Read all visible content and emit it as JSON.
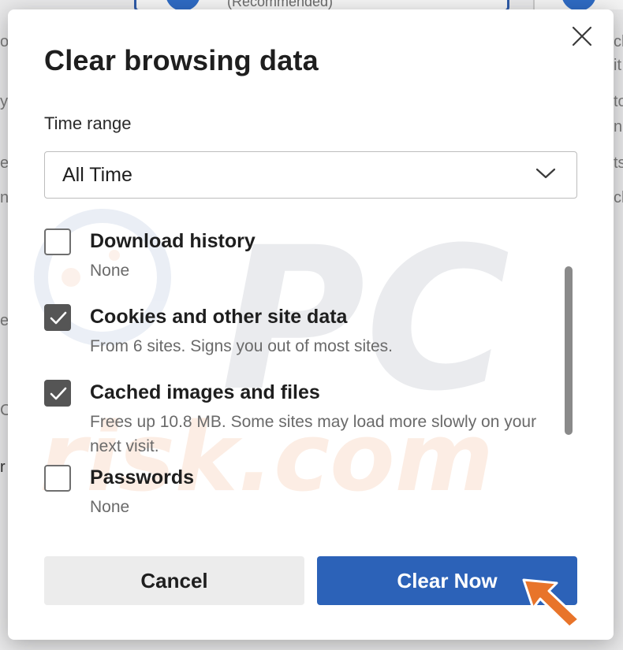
{
  "background": {
    "recommended_text": "(Recommended)",
    "left_fragments": [
      "o",
      "y",
      "e",
      "n",
      "e",
      "C",
      "r"
    ],
    "right_fragments": [
      "ck",
      "it",
      "to",
      "n",
      "ts",
      "ck"
    ]
  },
  "dialog": {
    "title": "Clear browsing data",
    "close_icon": "close-icon",
    "time_range": {
      "label": "Time range",
      "value": "All Time",
      "chevron_icon": "chevron-down-icon"
    },
    "items": [
      {
        "label": "Download history",
        "description": "None",
        "checked": false
      },
      {
        "label": "Cookies and other site data",
        "description": "From 6 sites. Signs you out of most sites.",
        "checked": true
      },
      {
        "label": "Cached images and files",
        "description": "Frees up 10.8 MB. Some sites may load more slowly on your next visit.",
        "checked": true
      },
      {
        "label": "Passwords",
        "description": "None",
        "checked": false
      }
    ],
    "buttons": {
      "cancel": "Cancel",
      "clear": "Clear Now"
    }
  },
  "colors": {
    "primary": "#2c62b8",
    "checkbox_checked": "#555555",
    "pointer_arrow": "#e8742a"
  },
  "watermark": {
    "top_text": "PC",
    "bottom_text": "risk.com"
  }
}
